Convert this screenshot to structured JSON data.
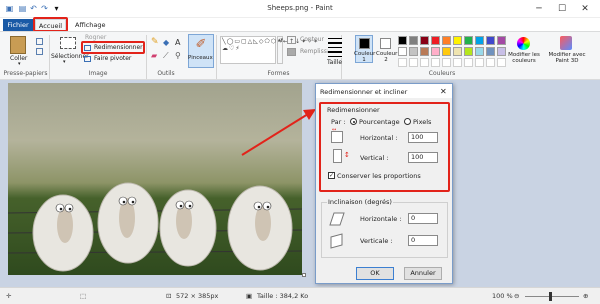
{
  "window": {
    "title": "Sheeps.png - Paint",
    "minimize": "─",
    "maximize": "☐",
    "close": "✕"
  },
  "tabs": {
    "file": "Fichier",
    "home": "Accueil",
    "view": "Affichage"
  },
  "ribbon": {
    "paste": "Coller",
    "select": "Sélectionner",
    "crop": "Rogner",
    "resize": "Redimensionner",
    "rotate": "Faire pivoter",
    "brushes": "Pinceaux",
    "outline": "Contour",
    "fill": "Remplissage",
    "size": "Taille",
    "color1": "Couleur 1",
    "color2": "Couleur 2",
    "edit_colors": "Modifier les couleurs",
    "paint3d": "Modifier avec Paint 3D",
    "groups": {
      "clipboard": "Presse-papiers",
      "image": "Image",
      "tools": "Outils",
      "shapes": "Formes",
      "colors": "Couleurs"
    },
    "palette": [
      "#000000",
      "#7f7f7f",
      "#880015",
      "#ed1c24",
      "#ff7f27",
      "#fff200",
      "#22b14c",
      "#00a2e8",
      "#3f48cc",
      "#a349a4",
      "#ffffff",
      "#c3c3c3",
      "#b97a57",
      "#ffaec9",
      "#ffc90e",
      "#efe4b0",
      "#b5e61d",
      "#99d9ea",
      "#7092be",
      "#c8bfe7"
    ]
  },
  "dialog": {
    "title": "Redimensionner et incliner",
    "close": "✕",
    "resize_group": "Redimensionner",
    "by_label": "Par :",
    "percent": "Pourcentage",
    "pixels": "Pixels",
    "horizontal_label": "Horizontal :",
    "horizontal_value": "100",
    "vertical_label": "Vertical :",
    "vertical_value": "100",
    "keep_ratio": "Conserver les proportions",
    "skew_group": "Inclinaison (degrés)",
    "skew_h_label": "Horizontale :",
    "skew_h_value": "0",
    "skew_v_label": "Verticale :",
    "skew_v_value": "0",
    "ok": "OK",
    "cancel": "Annuler"
  },
  "status": {
    "size": "572 × 385px",
    "filesize": "Taille : 384,2 Ko",
    "zoom": "100 %"
  }
}
